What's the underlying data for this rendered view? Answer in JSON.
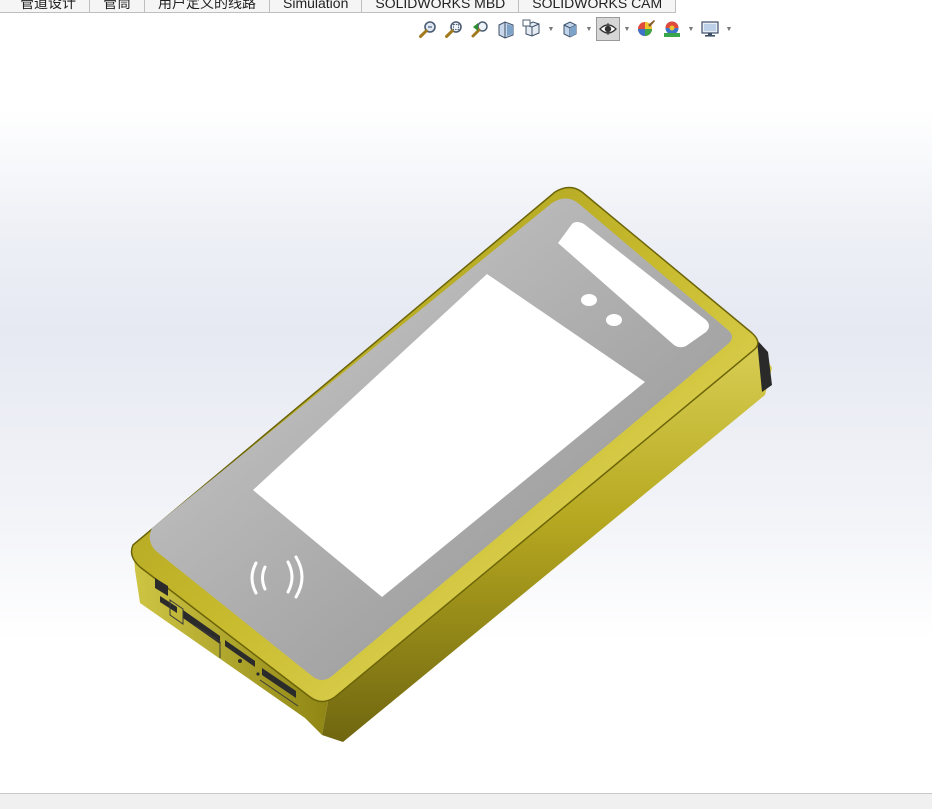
{
  "command_manager": {
    "tabs": [
      {
        "label": "管道设计"
      },
      {
        "label": "管筒"
      },
      {
        "label": "用户定义的线路"
      },
      {
        "label": "Simulation"
      },
      {
        "label": "SOLIDWORKS MBD"
      },
      {
        "label": "SOLIDWORKS CAM"
      }
    ]
  },
  "heads_up_toolbar": {
    "items": [
      {
        "icon": "zoom-to-fit-icon"
      },
      {
        "icon": "zoom-to-area-icon"
      },
      {
        "icon": "previous-view-icon"
      },
      {
        "icon": "section-view-icon"
      },
      {
        "icon": "view-orientation-icon",
        "has_dropdown": true
      },
      {
        "icon": "display-style-icon",
        "has_dropdown": true
      },
      {
        "icon": "hide-show-items-icon",
        "has_dropdown": true,
        "active": true
      },
      {
        "icon": "edit-appearance-icon"
      },
      {
        "icon": "apply-scene-icon",
        "has_dropdown": true
      },
      {
        "icon": "view-settings-icon",
        "has_dropdown": true
      }
    ]
  },
  "model": {
    "body_color": "#c3b72c",
    "bezel_color": "#9e9e9e",
    "screen_color": "#ffffff",
    "nfc_symbol": "nfc-icon"
  }
}
